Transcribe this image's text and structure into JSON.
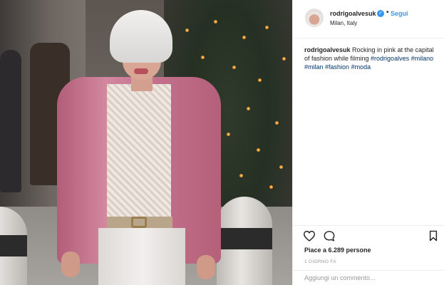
{
  "post": {
    "image_alt": "",
    "author": {
      "username": "rodrigoalvesuk",
      "verified_icon": "verified-badge-icon",
      "separator": "•",
      "follow_label": "Segui",
      "location": "Milan, Italy"
    },
    "caption": {
      "username": "rodrigoalvesuk",
      "text": " Rocking in pink at the capital of fashion while filming ",
      "hashtags": [
        "#rodrigoalves",
        "#milano",
        "#milan",
        "#fashion",
        "#moda"
      ]
    },
    "actions": {
      "like_icon": "heart-icon",
      "comment_icon": "comment-icon",
      "save_icon": "bookmark-icon"
    },
    "likes_text": "Piace a 6.289 persone",
    "time_ago": "1 GIORNO FA",
    "comment_placeholder": "Aggiungi un commento..."
  },
  "colors": {
    "link_blue": "#3897f0",
    "hashtag": "#003569",
    "jacket_pink": "#c5738f",
    "muted": "#999999"
  }
}
